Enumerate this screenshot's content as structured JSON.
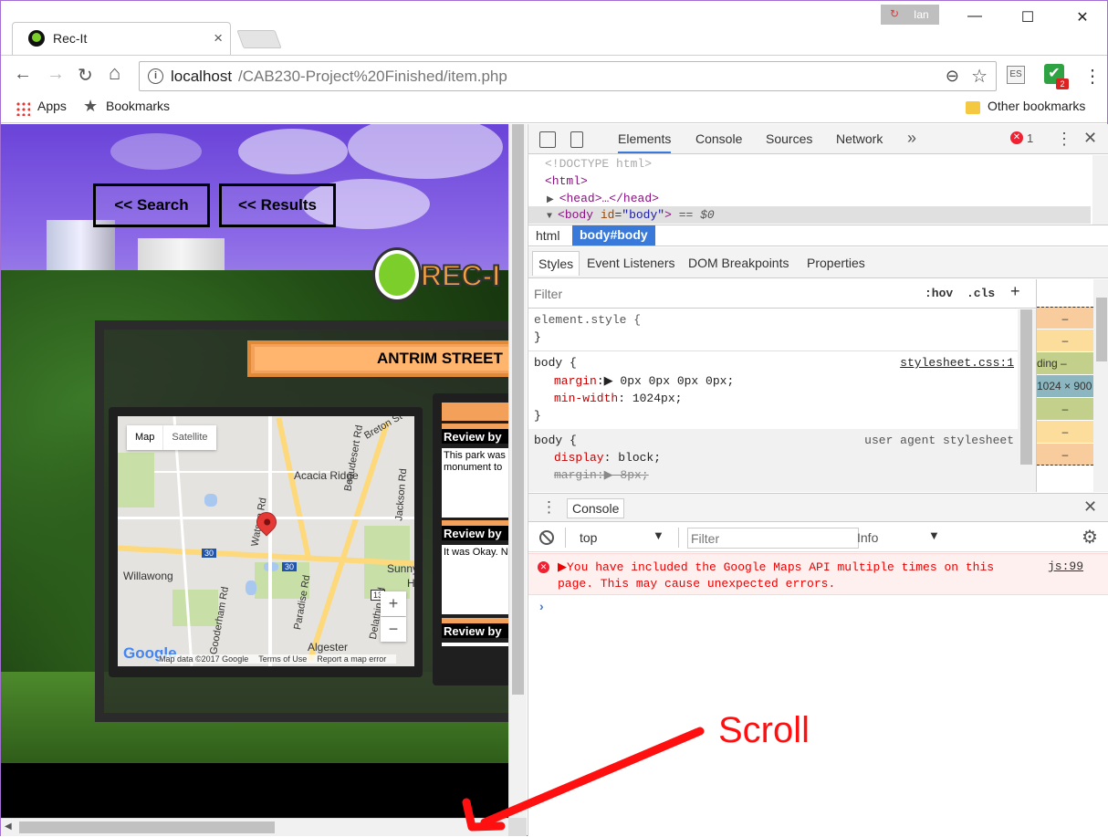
{
  "browser": {
    "tab_title": "Rec-It",
    "tab_close": "×",
    "user_name": "Ian",
    "sync_icon": "↻",
    "window_minimize": "—",
    "window_maximize": "☐",
    "window_close": "✕",
    "url_host": "localhost",
    "url_path": "/CAB230-Project%20Finished/item.php",
    "back": "←",
    "forward": "→",
    "reload": "↻",
    "home": "⌂",
    "zoom_icon": "⊖",
    "star_icon": "☆",
    "ext_es": "ES",
    "ext_check": "✔",
    "ext_badge": "2",
    "menu": "⋮",
    "bookmarks": {
      "apps": "Apps",
      "bookmarks": "Bookmarks",
      "other": "Other bookmarks"
    }
  },
  "page": {
    "nav_search": "<< Search",
    "nav_results": "<< Results",
    "logo_text": "REC-I",
    "item_title": "ANTRIM STREET",
    "map": {
      "type_map": "Map",
      "type_satellite": "Satellite",
      "labels": {
        "acacia_ridge": "Acacia Ridge",
        "willawong": "Willawong",
        "algester": "Algester",
        "sunny": "Sunny",
        "hi": "Hi",
        "watson_rd": "Watson Rd",
        "paradise_rd": "Paradise Rd",
        "jackson_rd": "Jackson Rd",
        "gooderham_rd": "Gooderham Rd",
        "beaudesert_rd": "Beaudesert Rd",
        "delathin_rd": "Delathin Rd",
        "breton_st": "Breton St",
        "route_30a": "30",
        "route_30b": "30",
        "route_13": "13"
      },
      "zoom_in": "+",
      "zoom_out": "−",
      "google": "Google",
      "data": "Map data ©2017 Google",
      "terms": "Terms of Use",
      "report": "Report a map error"
    },
    "reviews": [
      {
        "head": "Review by",
        "body_1": "This park was",
        "body_2": "monument to"
      },
      {
        "head": "Review by",
        "body_1": "It was Okay. N",
        "body_2": ""
      },
      {
        "head": "Review by",
        "body_1": "",
        "body_2": ""
      }
    ]
  },
  "devtools": {
    "tabs": [
      "Elements",
      "Console",
      "Sources",
      "Network"
    ],
    "more": "»",
    "error_count": "1",
    "error_icon": "✕",
    "dots": "⋮",
    "close": "✕",
    "dom": {
      "doctype": "<!DOCTYPE html>",
      "html_open": "<html>",
      "head_line": "<head>…</head>",
      "body_tag": "<body",
      "body_attr_name": "id",
      "body_attr_val": "\"body\"",
      "body_close": ">",
      "body_eq": " == $0"
    },
    "breadcrumb": {
      "html": "html",
      "body": "body#body"
    },
    "style_tabs": [
      "Styles",
      "Event Listeners",
      "DOM Breakpoints",
      "Properties"
    ],
    "filter_placeholder": "Filter",
    "hov": ":hov",
    "cls": ".cls",
    "plus": "+",
    "rules": {
      "element_style_open": "element.style {",
      "element_style_close": "}",
      "body1_open": "body {",
      "body1_src": "stylesheet.css:1",
      "body1_prop1": "margin",
      "body1_val1": "▶ 0px 0px 0px 0px;",
      "body1_prop2": "min-width",
      "body1_val2": " 1024px;",
      "body1_close": "}",
      "body2_open": "body {",
      "body2_src": "user agent stylesheet",
      "body2_prop1": "display",
      "body2_val1": " block;",
      "body2_prop2": "margin",
      "body2_val2": "▶ 8px;"
    },
    "boxmodel": [
      "–",
      "–",
      "ding –",
      "1024 × 900",
      "–",
      "–",
      "–"
    ],
    "console": {
      "dots": "⋮",
      "tab": "Console",
      "close": "✕",
      "context": "top",
      "arrow": "▼",
      "filter_placeholder": "Filter",
      "level": "Info",
      "level_arrow": "▼",
      "gear": "⚙",
      "error_line1": "▶You have included the Google Maps API multiple times on this",
      "error_line2": "page. This may cause unexpected errors.",
      "error_src": "js:99",
      "prompt": "›"
    }
  },
  "annotation": {
    "text": "Scroll",
    "color": "#ff1010"
  },
  "colors": {
    "accent_orange": "#f3a15a",
    "devtools_blue": "#3879d9",
    "error_red": "#e00"
  }
}
